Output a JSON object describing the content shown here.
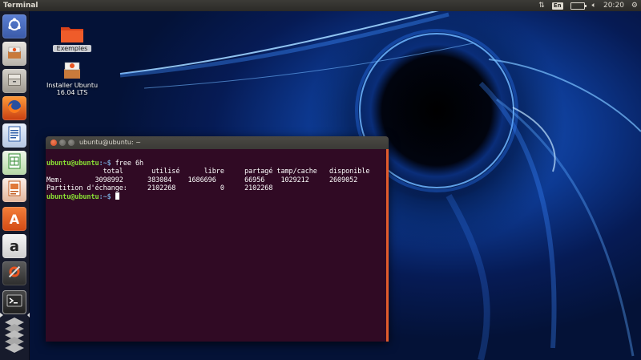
{
  "top_panel": {
    "title": "Terminal",
    "language": "En",
    "time": "20:20"
  },
  "launcher": {
    "items": [
      {
        "name": "dash-home",
        "icon": "ubuntu-logo-icon"
      },
      {
        "name": "install-ubuntu",
        "icon": "installer-icon"
      },
      {
        "name": "files",
        "icon": "file-manager-icon"
      },
      {
        "name": "firefox",
        "icon": "firefox-icon"
      },
      {
        "name": "libreoffice-writer",
        "icon": "writer-icon"
      },
      {
        "name": "libreoffice-calc",
        "icon": "calc-icon"
      },
      {
        "name": "libreoffice-impress",
        "icon": "impress-icon"
      },
      {
        "name": "software-center",
        "icon": "software-center-icon"
      },
      {
        "name": "amazon",
        "icon": "amazon-icon"
      },
      {
        "name": "system-settings",
        "icon": "settings-icon"
      },
      {
        "name": "terminal",
        "icon": "terminal-icon"
      },
      {
        "name": "workspaces",
        "icon": "workspace-switcher-icon"
      }
    ]
  },
  "desktop": {
    "icons": [
      {
        "label": "Exemples",
        "icon": "folder-icon",
        "selected": true
      },
      {
        "label_line1": "Installer Ubuntu",
        "label_line2": "16.04 LTS",
        "icon": "installer-icon"
      }
    ]
  },
  "terminal": {
    "title": "ubuntu@ubuntu: ~",
    "prompt_user": "ubuntu@ubuntu",
    "prompt_path": ":~$",
    "command": " free 6h",
    "header": "              total       utilisé      libre     partagé tamp/cache   disponible",
    "mem": "Mem:        3098992      383084    1686696       66956    1029212     2609052",
    "swap": "Partition d'échange:     2102268           0     2102268",
    "final_prompt_suffix": " "
  },
  "colors": {
    "terminal_bg": "#300a24",
    "prompt_user": "#8ae234",
    "prompt_path": "#729fcf",
    "scrollbar": "#e35c2c"
  }
}
